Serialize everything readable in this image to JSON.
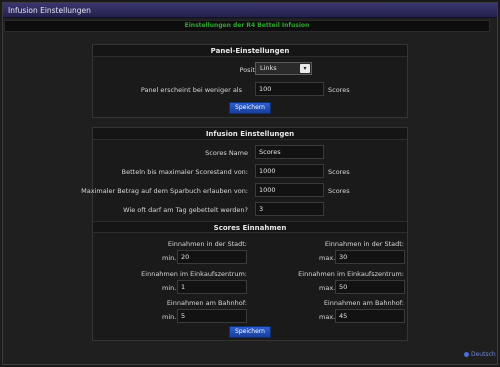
{
  "window": {
    "title": "Infusion Einstellungen"
  },
  "notice": "Einstellungen der R4 Betteil Infusion",
  "panel_settings": {
    "header": "Panel-Einstellungen",
    "position_label": "Position:",
    "position_value": "Links",
    "threshold_label": "Panel erscheint bei weniger als",
    "threshold_value": "100",
    "threshold_unit": "Scores",
    "save_label": "Speichern"
  },
  "infusion_settings": {
    "header": "Infusion Einstellungen",
    "scores_name_label": "Scores Name",
    "scores_name_value": "Scores",
    "max_score_label": "Betteln bis maximaler Scorestand von:",
    "max_score_value": "1000",
    "max_score_unit": "Scores",
    "max_amount_label": "Maximaler Betrag auf dem Sparbuch erlauben von:",
    "max_amount_value": "1000",
    "max_amount_unit": "Scores",
    "per_day_label": "Wie oft darf am Tag gebettelt werden?",
    "per_day_value": "3"
  },
  "income": {
    "header": "Scores Einnahmen",
    "min_prefix": "min.",
    "max_prefix": "max.",
    "city_label": "Einnahmen in der Stadt:",
    "mall_label": "Einnahmen im Einkaufszentrum:",
    "station_label": "Einnahmen am Bahnhof:",
    "city_min": "20",
    "city_max": "30",
    "mall_min": "1",
    "mall_max": "50",
    "station_min": "5",
    "station_max": "45",
    "save_label": "Speichern"
  },
  "footer": {
    "link_label": "Deutsch"
  },
  "colors": {
    "titlebar": "#2e2a5e",
    "notice_text": "#2fa82f",
    "button": "#2452bf",
    "background": "#1b1b1b"
  },
  "icons": {
    "select_arrow": "chevron-down-icon",
    "footer": "globe-dot-icon"
  }
}
